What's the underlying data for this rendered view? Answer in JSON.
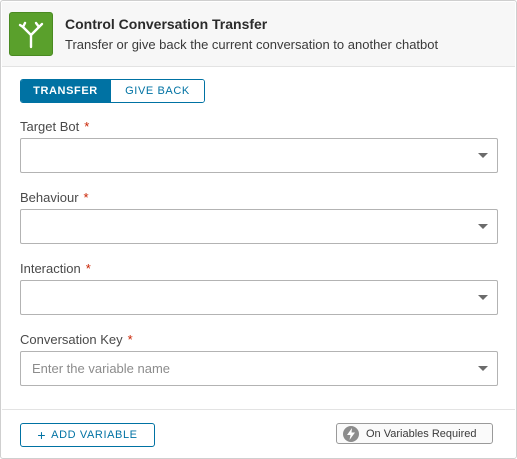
{
  "header": {
    "title": "Control Conversation Transfer",
    "subtitle": "Transfer or give back the current conversation to another chatbot",
    "icon": "merge-arrows-icon",
    "icon_color": "#5aa02c"
  },
  "mode_toggle": {
    "options": [
      "TRANSFER",
      "GIVE BACK"
    ],
    "selected": "TRANSFER",
    "accent": "#0072a3"
  },
  "fields": [
    {
      "label": "Target Bot",
      "required_mark": "*",
      "value": "",
      "placeholder": ""
    },
    {
      "label": "Behaviour",
      "required_mark": "*",
      "value": "",
      "placeholder": ""
    },
    {
      "label": "Interaction",
      "required_mark": "*",
      "value": "",
      "placeholder": ""
    },
    {
      "label": "Conversation Key",
      "required_mark": "*",
      "value": "",
      "placeholder": "Enter the variable name"
    }
  ],
  "footer": {
    "add_variable_label": "ADD VARIABLE",
    "add_variable_icon": "+",
    "on_variables_label": "On Variables Required",
    "on_variables_icon": "lightning-bolt-icon"
  },
  "colors": {
    "required": "#c92100"
  }
}
